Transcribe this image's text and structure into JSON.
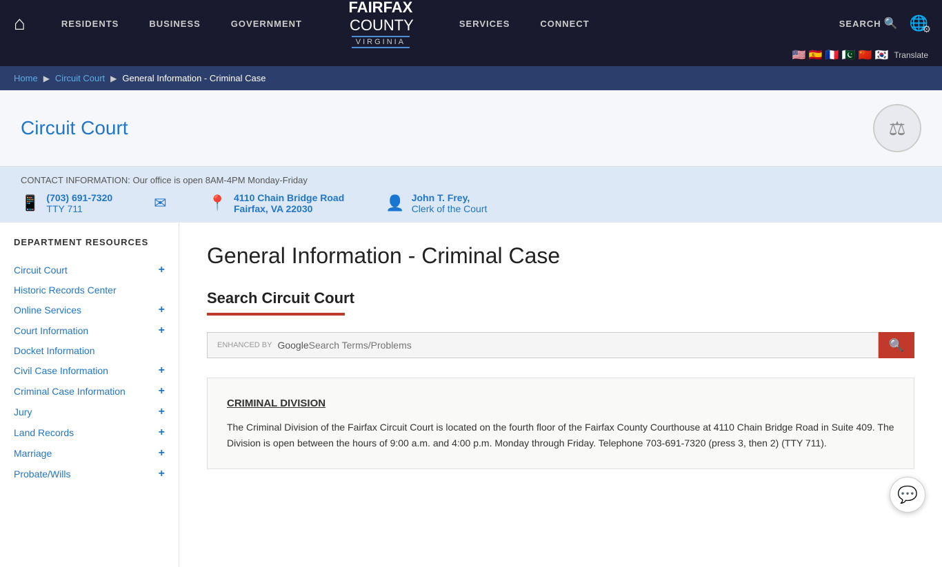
{
  "nav": {
    "home_icon": "⌂",
    "items": [
      {
        "label": "RESIDENTS"
      },
      {
        "label": "BUSINESS"
      },
      {
        "label": "GOVERNMENT"
      },
      {
        "label": "SERVICES"
      },
      {
        "label": "CONNECT"
      }
    ],
    "logo": {
      "fairfax": "FAIRFAX",
      "county": "COUNTY",
      "virginia": "VIRGINIA"
    },
    "search_label": "SEARCH",
    "globe_icon": "🌐",
    "gear_icon": "⚙",
    "translate_label": "Translate"
  },
  "breadcrumb": {
    "home": "Home",
    "circuit_court": "Circuit Court",
    "current": "General Information - Criminal Case"
  },
  "page_header": {
    "title": "Circuit Court",
    "seal_icon": "⚖"
  },
  "contact": {
    "info_title": "CONTACT INFORMATION: Our office is open 8AM-4PM Monday-Friday",
    "phone": "(703) 691-7320",
    "tty": "TTY 711",
    "phone_icon": "📱",
    "email_icon": "✉",
    "address_icon": "📍",
    "address_line1": "4110 Chain Bridge Road",
    "address_line2": "Fairfax, VA 22030",
    "person_icon": "👤",
    "clerk_name": "John T. Frey,",
    "clerk_title": "Clerk of the Court"
  },
  "sidebar": {
    "dept_label": "DEPARTMENT RESOURCES",
    "items": [
      {
        "label": "Circuit Court",
        "has_plus": true
      },
      {
        "label": "Historic Records Center",
        "has_plus": false
      },
      {
        "label": "Online Services",
        "has_plus": true
      },
      {
        "label": "Court Information",
        "has_plus": true
      },
      {
        "label": "Docket Information",
        "has_plus": false
      },
      {
        "label": "Civil Case Information",
        "has_plus": true
      },
      {
        "label": "Criminal Case Information",
        "has_plus": true
      },
      {
        "label": "Jury",
        "has_plus": true
      },
      {
        "label": "Land Records",
        "has_plus": true
      },
      {
        "label": "Marriage",
        "has_plus": true
      },
      {
        "label": "Probate/Wills",
        "has_plus": true
      }
    ]
  },
  "content": {
    "page_title": "General Information - Criminal Case",
    "search_section_title": "Search Circuit Court",
    "search_placeholder": "Search Terms/Problems",
    "search_icon": "🔍",
    "enhanced_label": "ENHANCED BY",
    "google_label": "Google",
    "division_title": "CRIMINAL DIVISION",
    "division_text": "The Criminal Division of the Fairfax Circuit Court is located on the fourth floor of the Fairfax County Courthouse at 4110 Chain Bridge Road in Suite 409. The Division is open between the hours of 9:00 a.m. and 4:00 p.m. Monday through Friday. Telephone 703-691-7320 (press 3, then 2) (TTY 711)."
  }
}
